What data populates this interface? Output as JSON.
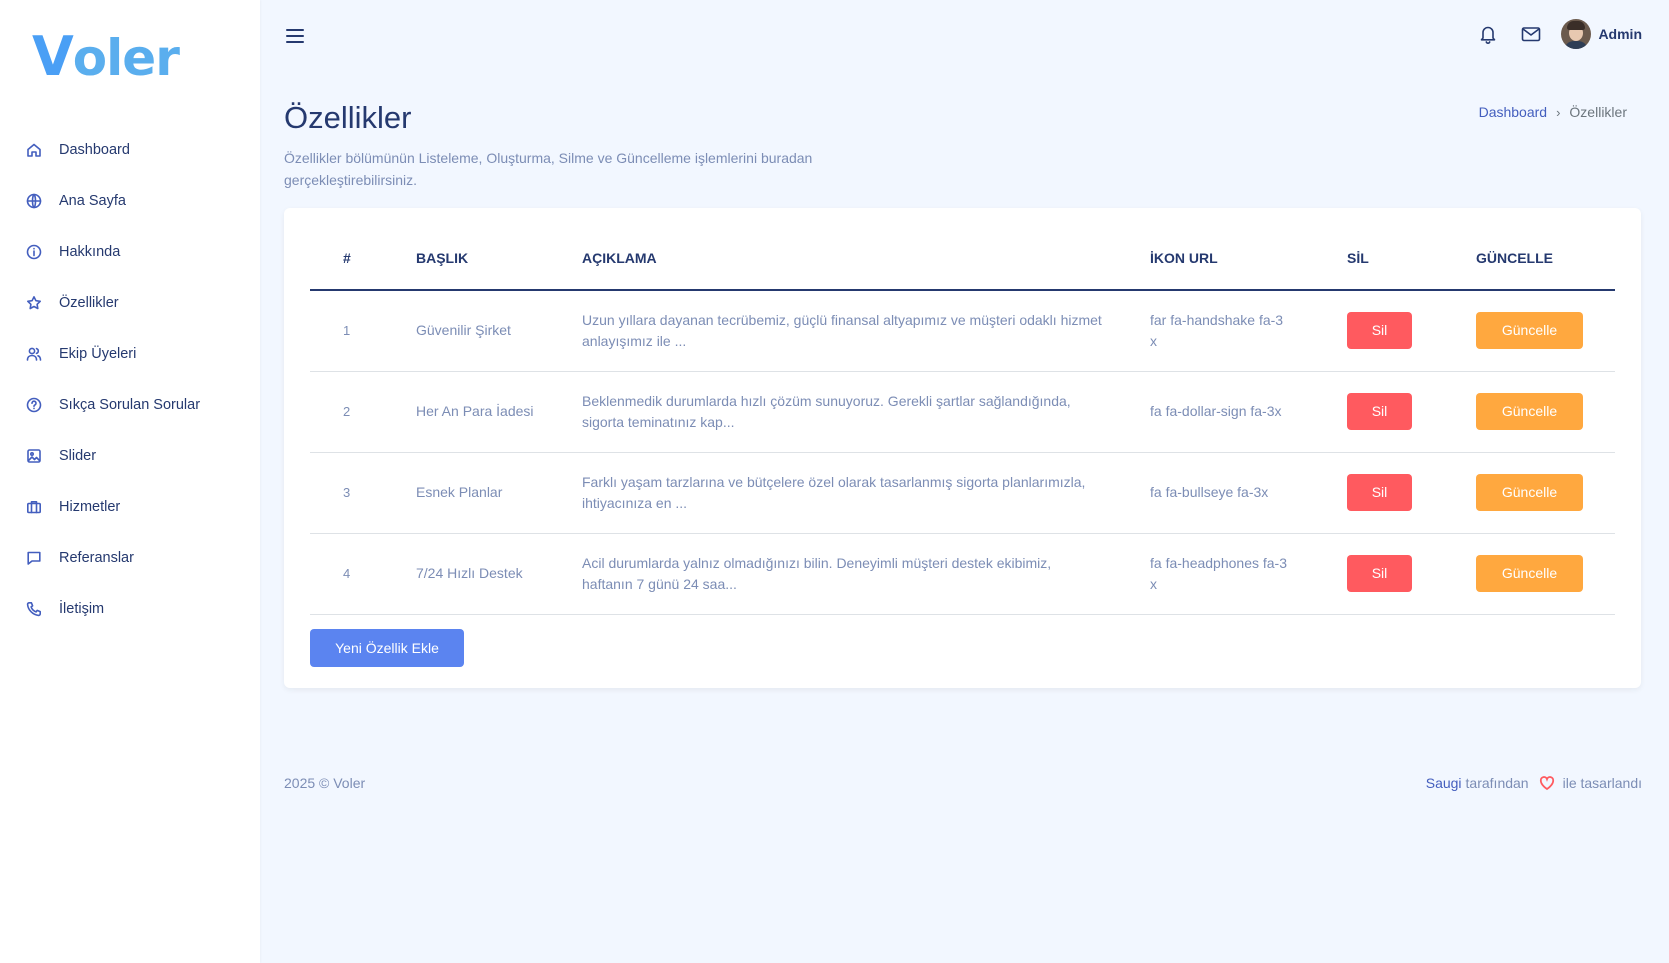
{
  "brand": {
    "first_letter": "V",
    "rest": "oler"
  },
  "sidebar": {
    "items": [
      {
        "label": "Dashboard",
        "icon": "home-icon"
      },
      {
        "label": "Ana Sayfa",
        "icon": "globe-icon"
      },
      {
        "label": "Hakkında",
        "icon": "info-icon"
      },
      {
        "label": "Özellikler",
        "icon": "star-icon"
      },
      {
        "label": "Ekip Üyeleri",
        "icon": "people-icon"
      },
      {
        "label": "Sıkça Sorulan Sorular",
        "icon": "question-icon"
      },
      {
        "label": "Slider",
        "icon": "image-icon"
      },
      {
        "label": "Hizmetler",
        "icon": "briefcase-icon"
      },
      {
        "label": "Referanslar",
        "icon": "chat-icon"
      },
      {
        "label": "İletişim",
        "icon": "phone-icon"
      }
    ]
  },
  "header": {
    "user_name": "Admin"
  },
  "page": {
    "title": "Özellikler",
    "subtitle": "Özellikler bölümünün Listeleme, Oluşturma, Silme ve Güncelleme işlemlerini buradan gerçekleştirebilirsiniz."
  },
  "breadcrumb": {
    "home": "Dashboard",
    "current": "Özellikler"
  },
  "table": {
    "columns": [
      "#",
      "BAŞLIK",
      "AÇIKLAMA",
      "İKON URL",
      "SİL",
      "GÜNCELLE"
    ],
    "rows": [
      {
        "id": "1",
        "title": "Güvenilir Şirket",
        "description": "Uzun yıllara dayanan tecrübemiz, güçlü finansal altyapımız ve müşteri odaklı hizmet anlayışımız ile ...",
        "icon_url": "far fa-handshake fa-3x",
        "delete_label": "Sil",
        "update_label": "Güncelle"
      },
      {
        "id": "2",
        "title": "Her An Para İadesi",
        "description": "Beklenmedik durumlarda hızlı çözüm sunuyoruz. Gerekli şartlar sağlandığında, sigorta teminatınız kap...",
        "icon_url": "fa fa-dollar-sign fa-3x",
        "delete_label": "Sil",
        "update_label": "Güncelle"
      },
      {
        "id": "3",
        "title": "Esnek Planlar",
        "description": "Farklı yaşam tarzlarına ve bütçelere özel olarak tasarlanmış sigorta planlarımızla, ihtiyacınıza en ...",
        "icon_url": "fa fa-bullseye fa-3x",
        "delete_label": "Sil",
        "update_label": "Güncelle"
      },
      {
        "id": "4",
        "title": "7/24 Hızlı Destek",
        "description": "Acil durumlarda yalnız olmadığınızı bilin. Deneyimli müşteri destek ekibimiz, haftanın 7 günü 24 saa...",
        "icon_url": "fa fa-headphones fa-3x",
        "delete_label": "Sil",
        "update_label": "Güncelle"
      }
    ],
    "add_button": "Yeni Özellik Ekle"
  },
  "footer": {
    "copyright": "2025 © Voler",
    "author": "Saugi",
    "by_text": "tarafından",
    "designed_text": "ile tasarlandı"
  },
  "colors": {
    "primary": "#435ebe",
    "danger": "#ff5a5f",
    "warning": "#ffa83f",
    "add_button": "#5b84f0"
  }
}
